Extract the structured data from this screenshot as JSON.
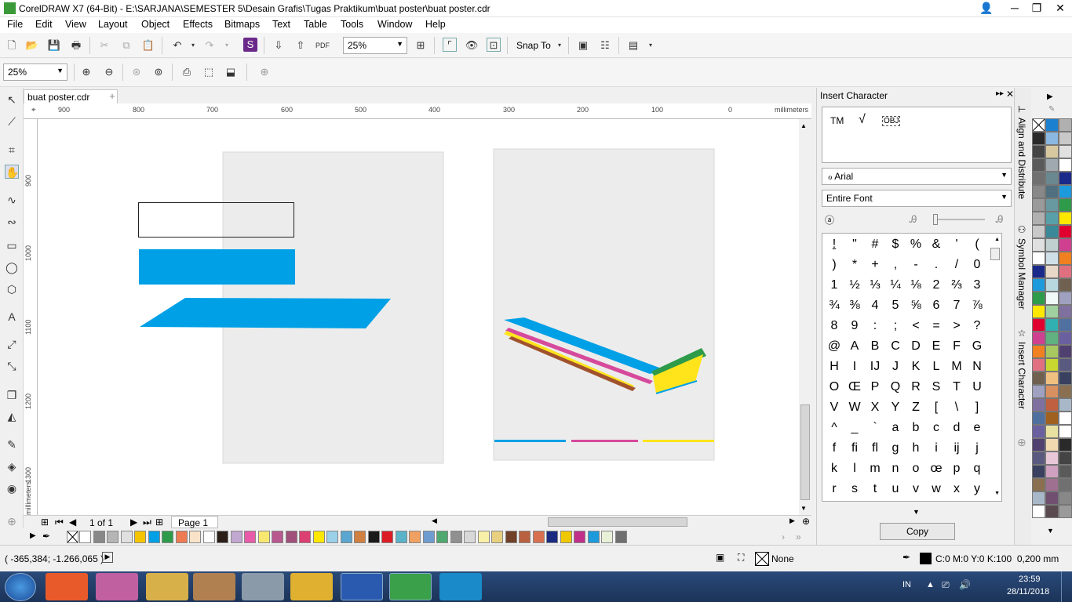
{
  "window": {
    "title": "CorelDRAW X7 (64-Bit) - E:\\SARJANA\\SEMESTER 5\\Desain Grafis\\Tugas Praktikum\\buat poster\\buat poster.cdr"
  },
  "menu": [
    "File",
    "Edit",
    "View",
    "Layout",
    "Object",
    "Effects",
    "Bitmaps",
    "Text",
    "Table",
    "Tools",
    "Window",
    "Help"
  ],
  "toolbar": {
    "zoom_value": "25%",
    "snap_label": "Snap To"
  },
  "toolbar2": {
    "zoom_value": "25%"
  },
  "document": {
    "tab_label": "buat poster.cdr"
  },
  "ruler": {
    "h_ticks": [
      "900",
      "800",
      "700",
      "600",
      "500",
      "400",
      "300",
      "200",
      "100",
      "0",
      "millimeters"
    ],
    "v_ticks": [
      "900",
      "1000",
      "1100",
      "1200",
      "1300"
    ],
    "v_unit": "millimeters"
  },
  "pager": {
    "page_count": "1 of 1",
    "page_tab": "Page 1"
  },
  "docker": {
    "title": "Insert Character",
    "preview_chars": [
      "TM",
      "√",
      "OBJ"
    ],
    "font": "Arial",
    "subset": "Entire Font",
    "copy_label": "Copy",
    "characters": [
      "!",
      "\"",
      "#",
      "$",
      "%",
      "&",
      "'",
      "(",
      ")",
      "*",
      "+",
      ",",
      "-",
      ".",
      "/",
      "0",
      "1",
      "½",
      "⅓",
      "¼",
      "⅛",
      "2",
      "⅔",
      "3",
      "¾",
      "⅜",
      "4",
      "5",
      "⅝",
      "6",
      "7",
      "⅞",
      "8",
      "9",
      ":",
      ";",
      "<",
      "=",
      ">",
      "?",
      "@",
      "A",
      "B",
      "C",
      "D",
      "E",
      "F",
      "G",
      "H",
      "I",
      "IJ",
      "J",
      "K",
      "L",
      "M",
      "N",
      "O",
      "Œ",
      "P",
      "Q",
      "R",
      "S",
      "T",
      "U",
      "V",
      "W",
      "X",
      "Y",
      "Z",
      "[",
      "\\",
      "]",
      "^",
      "_",
      "`",
      "a",
      "b",
      "c",
      "d",
      "e",
      "f",
      "ﬁ",
      "ﬂ",
      "g",
      "h",
      "i",
      "ij",
      "j",
      "k",
      "l",
      "m",
      "n",
      "o",
      "œ",
      "p",
      "q",
      "r",
      "s",
      "t",
      "u",
      "v",
      "w",
      "x",
      "y"
    ]
  },
  "docker_tabs": [
    "Align and Distribute",
    "Symbol Manager",
    "Insert Character"
  ],
  "statusbar": {
    "coords": "( -365,384; -1.266,065 )",
    "fill": "None",
    "outline": "C:0 M:0 Y:0 K:100  0,200 mm"
  },
  "taskbar": {
    "lang": "IN",
    "time": "23:59",
    "date": "28/11/2018"
  },
  "colors": {
    "blue": "#00a0e6",
    "magenta": "#d64a9b",
    "yellow": "#ffe41c",
    "brown": "#a0522d",
    "green": "#2e9b4a",
    "page": "#ececec"
  },
  "doc_palette": [
    "#ffffff",
    "#888888",
    "#b5b5b5",
    "#e0e0e0",
    "#f5c400",
    "#00a0e6",
    "#2e9b4a",
    "#ee7b52",
    "#f9e3c8",
    "#ffffff",
    "#2a1e16",
    "#c0a8d0",
    "#e85ba8",
    "#f8e870",
    "#b8588f",
    "#a0507a",
    "#dc3f72",
    "#ffe700",
    "#9ad0e8",
    "#5aa6d0",
    "#d08040",
    "#1a1a1a",
    "#dc1c24",
    "#5ab3c8",
    "#f0a060",
    "#6f9cd0",
    "#4ea870",
    "#909090",
    "#d8d8d8",
    "#f8f0a8",
    "#e8d080",
    "#704028",
    "#b86040",
    "#d87050",
    "#1a2a80",
    "#f0c800",
    "#c0308a",
    "#1c9adc",
    "#e8f0d8",
    "#707070"
  ],
  "palette_col1": [
    "#ffffff",
    "#2a2a2a",
    "#444444",
    "#5a5a5a",
    "#707070",
    "#888888",
    "#9a9a9a",
    "#b0b0b0",
    "#c8c8c8",
    "#e0e0e0",
    "#ffffff",
    "#1a2a8a",
    "#1c9adc",
    "#2e9b4a",
    "#ffe700",
    "#e00030",
    "#d04090",
    "#f08020",
    "#e07080",
    "#706050",
    "#a0a0c0",
    "#8070a0",
    "#5070a0",
    "#6a60a0",
    "#504070",
    "#5a5a80",
    "#3a4060",
    "#8a7050",
    "#a8b8c8",
    "#ffffff"
  ],
  "palette_col2": [
    "#1c80d0",
    "#8ab8e0",
    "#d8c8a0",
    "#a0a8b0",
    "#6a8890",
    "#507080",
    "#6898a0",
    "#58a0a8",
    "#3a8898",
    "#c0d0d0",
    "#d0e0e8",
    "#e8d8c8",
    "#b8d8e0",
    "#f0f8f8",
    "#a0d0a0",
    "#30b0b0",
    "#60b080",
    "#a8c860",
    "#c8d830",
    "#f0c080",
    "#d89060",
    "#c06040",
    "#a06020",
    "#e8e0a0",
    "#f0d8b0",
    "#e8c8d8",
    "#d0a0c0",
    "#a07090",
    "#705070",
    "#5a4a50"
  ]
}
